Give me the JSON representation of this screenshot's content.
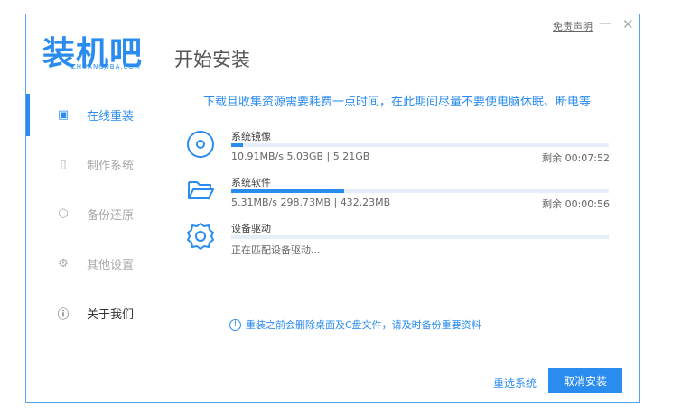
{
  "logo": {
    "text": "装机吧",
    "sub": "ZHUANGJIBA.COM"
  },
  "header": {
    "title": "开始安装",
    "disclaimer": "免责声明",
    "minimize": "—",
    "close": "✕"
  },
  "sidebar": {
    "items": [
      {
        "label": "在线重装",
        "icon": "monitor-icon",
        "glyph": "▣"
      },
      {
        "label": "制作系统",
        "icon": "usb-icon",
        "glyph": "▯"
      },
      {
        "label": "备份还原",
        "icon": "cube-icon",
        "glyph": "⬡"
      },
      {
        "label": "其他设置",
        "icon": "gear-icon",
        "glyph": "⚙"
      },
      {
        "label": "关于我们",
        "icon": "info-icon",
        "glyph": "ⓘ"
      }
    ]
  },
  "main": {
    "headline": "下载且收集资源需要耗费一点时间，在此期间尽量不要使电脑休眠、断电等",
    "tasks": [
      {
        "name": "系统镜像",
        "stats": "10.91MB/s 5.03GB | 5.21GB",
        "remaining": "剩余 00:07:52",
        "progress": 0.03,
        "icon": "disc-icon"
      },
      {
        "name": "系统软件",
        "stats": "5.31MB/s 298.73MB | 432.23MB",
        "remaining": "剩余 00:00:56",
        "progress": 0.3,
        "icon": "folder-icon"
      },
      {
        "name": "设备驱动",
        "stats": "正在匹配设备驱动...",
        "progress": 0,
        "icon": "gear-icon"
      }
    ],
    "warning": "重装之前会删除桌面及C盘文件，请及时备份重要资料",
    "reselect": "重选系统",
    "cancel": "取消安装"
  }
}
